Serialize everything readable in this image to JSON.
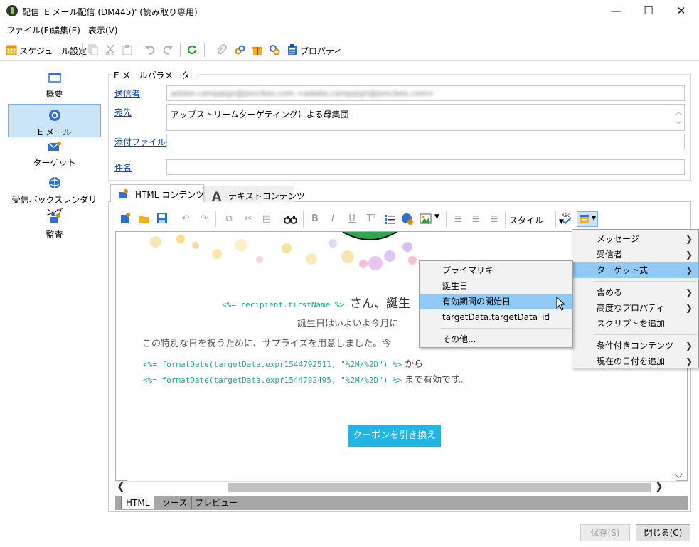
{
  "window": {
    "title": "配信 'E メール配信 (DM445)' (読み取り専用)",
    "minimize": "—",
    "maximize": "☐",
    "close": "✕"
  },
  "menubar": [
    "ファイル(F)",
    "編集(E)",
    "表示(V)"
  ],
  "toolbar": {
    "schedule_label": "スケジュール設定",
    "properties_label": "プロパティ"
  },
  "nav": [
    {
      "label": "概要",
      "icon": "overview-icon"
    },
    {
      "label": "E メール",
      "icon": "email-icon"
    },
    {
      "label": "ターゲット",
      "icon": "target-icon"
    },
    {
      "label": "受信ボックスレンダリング",
      "icon": "inbox-rendering-icon"
    },
    {
      "label": "監査",
      "icon": "audit-icon"
    }
  ],
  "params": {
    "legend": "E メールパラメーター",
    "sender_label": "送信者",
    "sender_value": "adobe.campaign@joncikes.com <adobe.campaign@joncikes.com>",
    "to_label": "宛先",
    "to_value": "アップストリームターゲティングによる母集団",
    "attach_label": "添付ファイル",
    "subject_label": "件名"
  },
  "tabs": {
    "html": "HTML コンテンツ",
    "text": "テキストコンテンツ"
  },
  "editor": {
    "style_label": "スタイル",
    "line1_code": "<%= recipient.firstName %>",
    "line1_text": "さん、誕生",
    "line2": "誕生日はいよいよ今月に",
    "line3": "この特別な日を祝うために、サプライズを用意しました。今",
    "line4_code": "<%= formatDate(targetData.expr1544792511, \"%2M/%2D\") %>",
    "line4_text": "から",
    "line5_code": "<%= formatDate(targetData.expr1544792495, \"%2M/%2D\") %>",
    "line5_text": "まで有効です。",
    "coupon": "クーポンを引き換え"
  },
  "bottom_tabs": [
    "HTML",
    "ソース",
    "プレビュー"
  ],
  "buttons": {
    "save": "保存(S)",
    "close": "閉じる(C)"
  },
  "context_menu": [
    {
      "label": "メッセージ",
      "submenu": true
    },
    {
      "label": "受信者",
      "submenu": true
    },
    {
      "label": "ターゲット式",
      "submenu": true,
      "highlighted": true
    },
    {
      "separator": true
    },
    {
      "label": "含める",
      "submenu": true
    },
    {
      "label": "高度なプロパティ",
      "submenu": true
    },
    {
      "label": "スクリプトを追加",
      "submenu": false
    },
    {
      "separator": true
    },
    {
      "label": "条件付きコンテンツ",
      "submenu": true
    },
    {
      "label": "現在の日付を追加",
      "submenu": true
    }
  ],
  "submenu": [
    {
      "label": "プライマリキー"
    },
    {
      "label": "誕生日"
    },
    {
      "label": "有効期間の開始日",
      "highlighted": true
    },
    {
      "label": "targetData.targetData_id"
    },
    {
      "separator": true
    },
    {
      "label": "その他..."
    }
  ],
  "colors": {
    "accent": "#20b5e3",
    "nav_active": "#cce4f7",
    "menu_highlight": "#91c9f7",
    "code": "#2aa198"
  }
}
